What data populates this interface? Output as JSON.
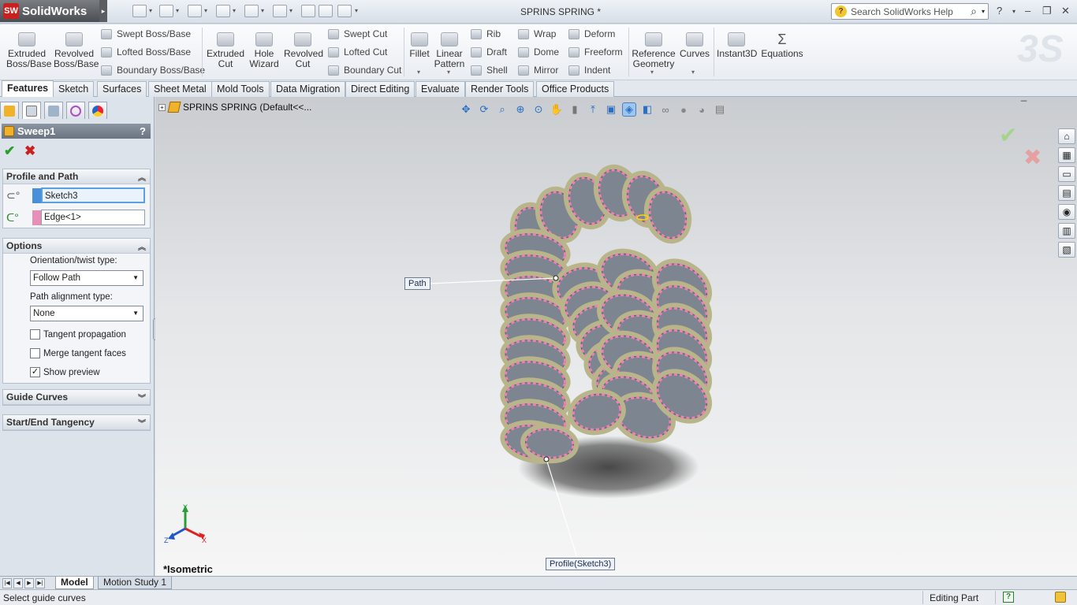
{
  "app": {
    "name": "SolidWorks",
    "doc_title": "SPRINS SPRING *"
  },
  "help_search": {
    "placeholder": "Search SolidWorks Help"
  },
  "ribbon": {
    "big_buttons": [
      {
        "label": "Extruded\nBoss/Base",
        "icon": "extruded-boss-icon"
      },
      {
        "label": "Revolved\nBoss/Base",
        "icon": "revolved-boss-icon"
      },
      {
        "label": "Extruded\nCut",
        "icon": "extruded-cut-icon"
      },
      {
        "label": "Hole\nWizard",
        "icon": "hole-wizard-icon"
      },
      {
        "label": "Revolved\nCut",
        "icon": "revolved-cut-icon"
      },
      {
        "label": "Fillet",
        "icon": "fillet-icon"
      },
      {
        "label": "Linear\nPattern",
        "icon": "linear-pattern-icon"
      },
      {
        "label": "Reference\nGeometry",
        "icon": "reference-geometry-icon"
      },
      {
        "label": "Curves",
        "icon": "curves-icon"
      },
      {
        "label": "Instant3D",
        "icon": "instant3d-icon"
      },
      {
        "label": "Equations",
        "icon": "equations-icon"
      }
    ],
    "small_buttons": [
      {
        "label": "Swept Boss/Base"
      },
      {
        "label": "Lofted Boss/Base"
      },
      {
        "label": "Boundary Boss/Base"
      },
      {
        "label": "Swept Cut"
      },
      {
        "label": "Lofted Cut"
      },
      {
        "label": "Boundary Cut"
      },
      {
        "label": "Rib"
      },
      {
        "label": "Draft"
      },
      {
        "label": "Shell"
      },
      {
        "label": "Wrap"
      },
      {
        "label": "Dome"
      },
      {
        "label": "Mirror"
      },
      {
        "label": "Deform"
      },
      {
        "label": "Freeform"
      },
      {
        "label": "Indent"
      }
    ]
  },
  "tabs": [
    "Features",
    "Sketch",
    "Surfaces",
    "Sheet Metal",
    "Mold Tools",
    "Data Migration",
    "Direct Editing",
    "Evaluate",
    "Render Tools",
    "Office Products"
  ],
  "property_manager": {
    "title": "Sweep1",
    "help": "?",
    "profile_and_path": {
      "title": "Profile and Path",
      "profile_value": "Sketch3",
      "path_value": "Edge<1>",
      "profile_color": "#4a90d9",
      "path_color": "#e88fb8"
    },
    "options": {
      "title": "Options",
      "orientation_label": "Orientation/twist type:",
      "orientation_value": "Follow Path",
      "alignment_label": "Path alignment type:",
      "alignment_value": "None",
      "tangent_propagation": "Tangent propagation",
      "tangent_propagation_checked": false,
      "merge_tangent_faces": "Merge tangent faces",
      "merge_tangent_faces_checked": false,
      "show_preview": "Show preview",
      "show_preview_checked": true
    },
    "guide_curves": "Guide Curves",
    "start_end_tangency": "Start/End Tangency"
  },
  "viewport": {
    "tree_label": "SPRINS SPRING  (Default<<...",
    "path_callout": "Path",
    "profile_callout": "Profile(Sketch3)",
    "view_label": "*Isometric",
    "triad": {
      "x": "X",
      "y": "Y",
      "z": "Z"
    },
    "spring_color": "#ef7fb4"
  },
  "bottom_tabs": [
    "Model",
    "Motion Study 1"
  ],
  "status": {
    "left": "Select guide curves",
    "mode": "Editing Part",
    "help": "?"
  }
}
